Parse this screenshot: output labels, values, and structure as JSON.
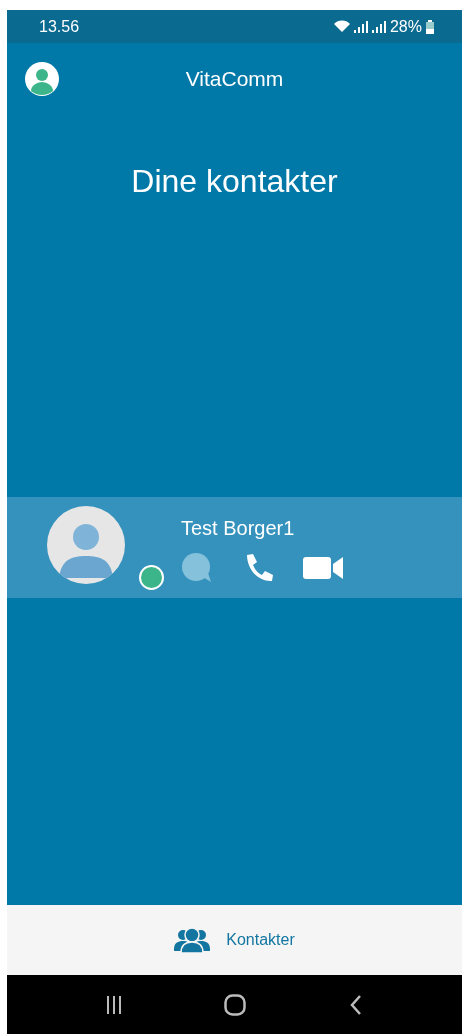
{
  "status_bar": {
    "time": "13.56",
    "battery": "28%"
  },
  "app_bar": {
    "title": "VitaComm"
  },
  "heading": "Dine kontakter",
  "contacts": [
    {
      "name": "Test Borger1",
      "online": true,
      "color": "#3db58a",
      "actions": [
        {
          "kind": "chat",
          "enabled": false
        },
        {
          "kind": "call",
          "enabled": true
        },
        {
          "kind": "video",
          "enabled": true
        }
      ]
    }
  ],
  "bottom_nav": [
    {
      "label": "Kontakter",
      "selected": true
    }
  ]
}
